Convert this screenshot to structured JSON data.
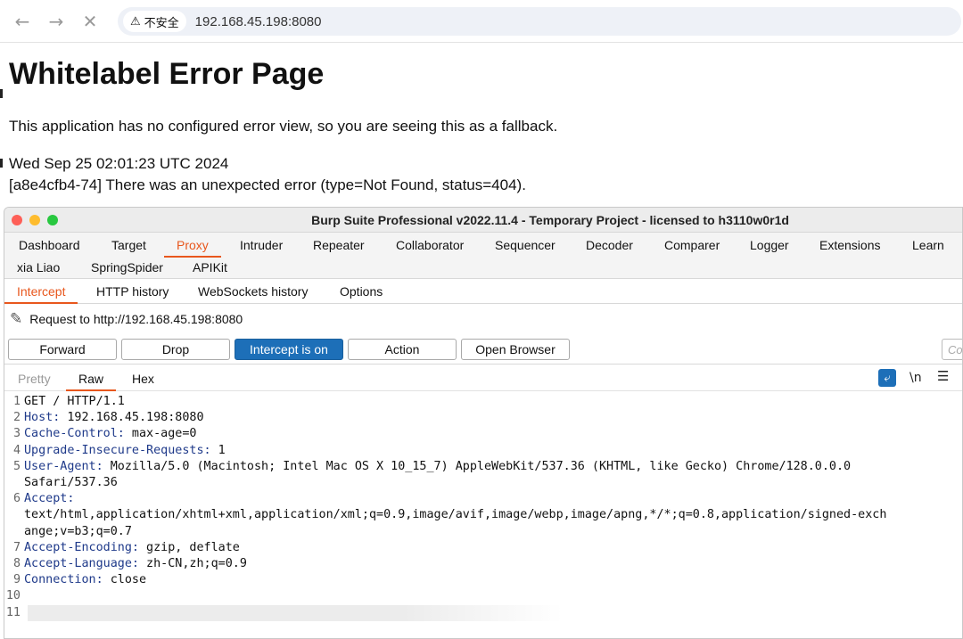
{
  "browser": {
    "security_label": "不安全",
    "url": "192.168.45.198:8080"
  },
  "page": {
    "heading": "Whitelabel Error Page",
    "message": "This application has no configured error view, so you are seeing this as a fallback.",
    "timestamp": "Wed Sep 25 02:01:23 UTC 2024",
    "error": "[a8e4cfb4-74] There was an unexpected error (type=Not Found, status=404)."
  },
  "burp": {
    "title": "Burp Suite Professional v2022.11.4 - Temporary Project - licensed to h3110w0r1d",
    "tabs_row1": [
      "Dashboard",
      "Target",
      "Proxy",
      "Intruder",
      "Repeater",
      "Collaborator",
      "Sequencer",
      "Decoder",
      "Comparer",
      "Logger",
      "Extensions",
      "Learn"
    ],
    "tabs_row2": [
      "xia Liao",
      "SpringSpider",
      "APIKit"
    ],
    "proxy_tabs": [
      "Intercept",
      "HTTP history",
      "WebSockets history",
      "Options"
    ],
    "request_to": "Request to http://192.168.45.198:8080",
    "buttons": {
      "forward": "Forward",
      "drop": "Drop",
      "intercept": "Intercept is on",
      "action": "Action",
      "open_browser": "Open Browser"
    },
    "comment_placeholder": "Co",
    "view_tabs": [
      "Pretty",
      "Raw",
      "Hex"
    ],
    "newline_toggle": "\\n",
    "request_lines": [
      {
        "n": "1",
        "key": "",
        "value": "GET / HTTP/1.1"
      },
      {
        "n": "2",
        "key": "Host",
        "value": " 192.168.45.198:8080"
      },
      {
        "n": "3",
        "key": "Cache-Control",
        "value": " max-age=0"
      },
      {
        "n": "4",
        "key": "Upgrade-Insecure-Requests",
        "value": " 1"
      },
      {
        "n": "5",
        "key": "User-Agent",
        "value": " Mozilla/5.0 (Macintosh; Intel Mac OS X 10_15_7) AppleWebKit/537.36 (KHTML, like Gecko) Chrome/128.0.0.0"
      },
      {
        "n": "",
        "key": "",
        "value": "Safari/537.36"
      },
      {
        "n": "6",
        "key": "Accept",
        "value": ""
      },
      {
        "n": "",
        "key": "",
        "value": "text/html,application/xhtml+xml,application/xml;q=0.9,image/avif,image/webp,image/apng,*/*;q=0.8,application/signed-exch"
      },
      {
        "n": "",
        "key": "",
        "value": "ange;v=b3;q=0.7"
      },
      {
        "n": "7",
        "key": "Accept-Encoding",
        "value": " gzip, deflate"
      },
      {
        "n": "8",
        "key": "Accept-Language",
        "value": " zh-CN,zh;q=0.9"
      },
      {
        "n": "9",
        "key": "Connection",
        "value": " close"
      },
      {
        "n": "10",
        "key": "",
        "value": ""
      },
      {
        "n": "11",
        "key": "",
        "value": ""
      }
    ]
  }
}
